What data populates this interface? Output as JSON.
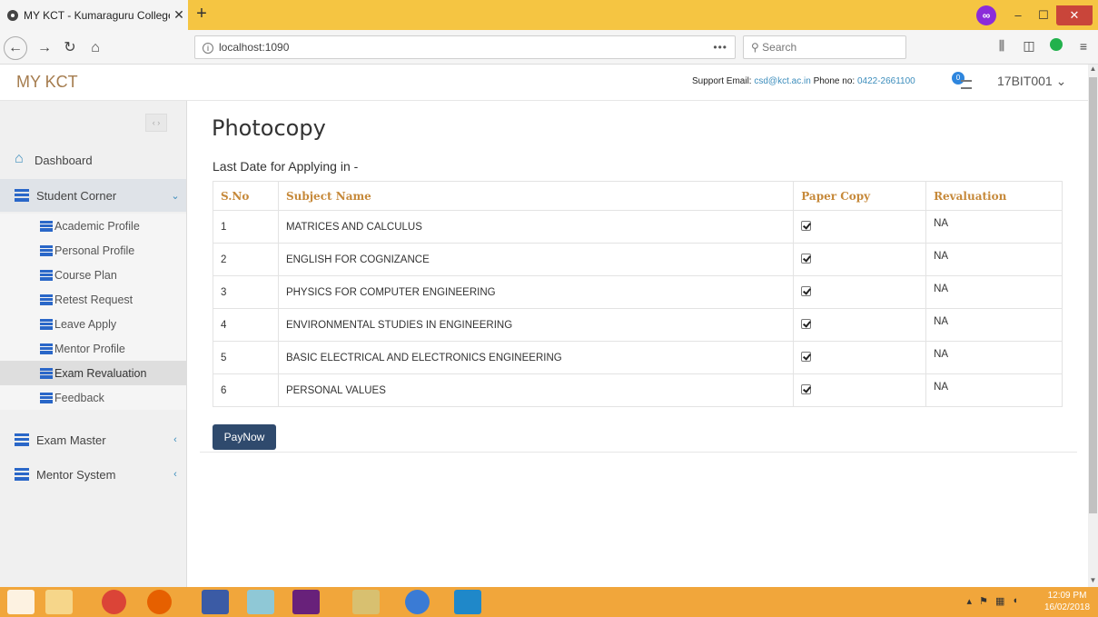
{
  "browser": {
    "tab_title": "MY KCT - Kumaraguru College",
    "tab_close": "✕",
    "new_tab": "+",
    "url": "localhost:1090",
    "url_menu": "•••",
    "search_placeholder": "Search",
    "minimize": "–",
    "maximize": "☐",
    "close": "✕"
  },
  "header": {
    "brand": "MY KCT",
    "support_label": "Support Email:",
    "support_email": "csd@kct.ac.in",
    "phone_label": "Phone no:",
    "phone": "0422-2661100",
    "notification_count": "0",
    "user": "17BIT001 ⌄"
  },
  "sidebar": {
    "toggle": "‹ ›",
    "dashboard": "Dashboard",
    "student_corner": "Student Corner",
    "student_corner_chev": "⌄",
    "submenu": [
      {
        "label": "Academic Profile"
      },
      {
        "label": "Personal Profile"
      },
      {
        "label": "Course Plan"
      },
      {
        "label": "Retest Request"
      },
      {
        "label": "Leave Apply"
      },
      {
        "label": "Mentor Profile"
      },
      {
        "label": "Exam Revaluation"
      },
      {
        "label": "Feedback"
      }
    ],
    "exam_master": "Exam Master",
    "mentor_system": "Mentor System",
    "collapsed_chev": "‹"
  },
  "main": {
    "title": "Photocopy",
    "last_date": "Last Date for Applying in -",
    "columns": [
      "S.No",
      "Subject Name",
      "Paper Copy",
      "Revaluation"
    ],
    "rows": [
      {
        "sno": "1",
        "subject": "MATRICES AND CALCULUS",
        "paper_copy": true,
        "revaluation": "NA"
      },
      {
        "sno": "2",
        "subject": "ENGLISH FOR COGNIZANCE",
        "paper_copy": true,
        "revaluation": "NA"
      },
      {
        "sno": "3",
        "subject": "PHYSICS FOR COMPUTER ENGINEERING",
        "paper_copy": true,
        "revaluation": "NA"
      },
      {
        "sno": "4",
        "subject": "ENVIRONMENTAL STUDIES IN ENGINEERING",
        "paper_copy": true,
        "revaluation": "NA"
      },
      {
        "sno": "5",
        "subject": "BASIC ELECTRICAL AND ELECTRONICS ENGINEERING",
        "paper_copy": true,
        "revaluation": "NA"
      },
      {
        "sno": "6",
        "subject": "PERSONAL VALUES",
        "paper_copy": true,
        "revaluation": "NA"
      }
    ],
    "pay_button": "PayNow"
  },
  "taskbar": {
    "time": "12:09 PM",
    "date": "16/02/2018"
  },
  "colors": {
    "accent": "#3c8dbc",
    "header_text": "#c6893a",
    "button": "#2f4a6d",
    "tabbar": "#f5c542",
    "taskbar": "#f1a63b"
  }
}
